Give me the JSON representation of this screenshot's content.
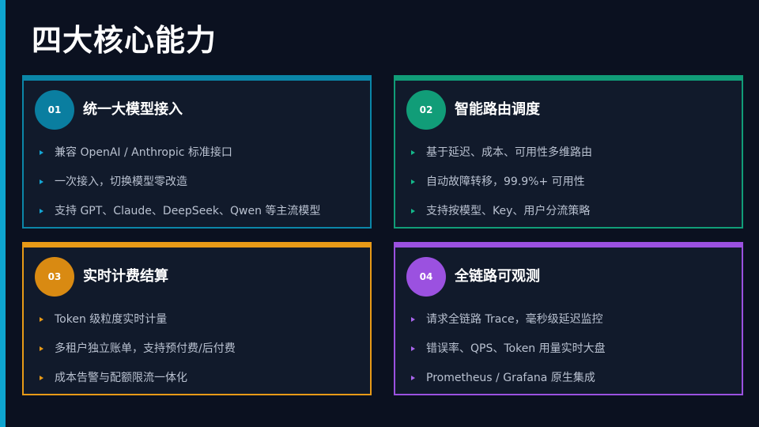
{
  "slide": {
    "title": "四大核心能力"
  },
  "colors": {
    "background": "#0b1120",
    "card_background": "#111a2b",
    "left_accent": "#0ea5d0",
    "card_1_accent": "#0b86a8",
    "card_2_accent": "#119d78",
    "card_3_accent": "#e89a17",
    "card_4_accent": "#9b51e0"
  },
  "cards": [
    {
      "number": "01",
      "title": "统一大模型接入",
      "items": [
        "兼容 OpenAI / Anthropic 标准接口",
        "一次接入，切换模型零改造",
        "支持 GPT、Claude、DeepSeek、Qwen 等主流模型"
      ]
    },
    {
      "number": "02",
      "title": "智能路由调度",
      "items": [
        "基于延迟、成本、可用性多维路由",
        "自动故障转移，99.9%+ 可用性",
        "支持按模型、Key、用户分流策略"
      ]
    },
    {
      "number": "03",
      "title": "实时计费结算",
      "items": [
        "Token 级粒度实时计量",
        "多租户独立账单，支持预付费/后付费",
        "成本告警与配额限流一体化"
      ]
    },
    {
      "number": "04",
      "title": "全链路可观测",
      "items": [
        "请求全链路 Trace，毫秒级延迟监控",
        "错误率、QPS、Token 用量实时大盘",
        "Prometheus / Grafana 原生集成"
      ]
    }
  ]
}
